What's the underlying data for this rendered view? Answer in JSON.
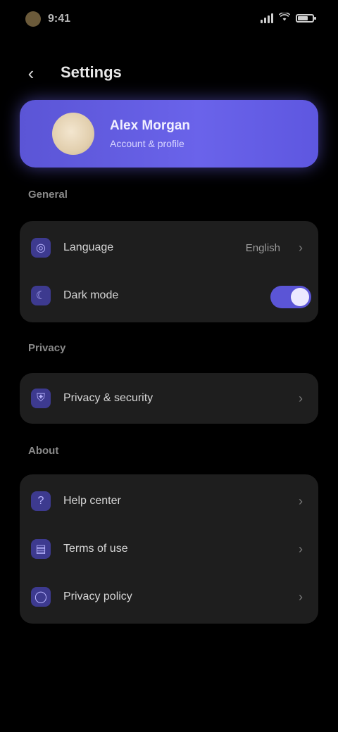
{
  "status_bar": {
    "time": "9:41",
    "battery_level": 0.8,
    "signal_level": 4
  },
  "header": {
    "title": "Settings",
    "back_icon": "chevron-left-icon"
  },
  "profile": {
    "name": "Alex Morgan",
    "subtitle": "Account & profile"
  },
  "sections": [
    {
      "label": "General",
      "rows": [
        {
          "label": "Language",
          "value": "English",
          "icon": "globe-icon",
          "control": "value"
        },
        {
          "label": "Dark mode",
          "icon": "moon-icon",
          "control": "toggle",
          "toggle_on": true
        }
      ]
    },
    {
      "label": "Privacy",
      "rows": [
        {
          "label": "Privacy & security",
          "icon": "shield-icon",
          "control": "chevron"
        }
      ]
    },
    {
      "label": "About",
      "rows": [
        {
          "label": "Help center",
          "icon": "help-icon",
          "control": "chevron"
        },
        {
          "label": "Terms of use",
          "icon": "document-icon",
          "control": "chevron"
        },
        {
          "label": "Privacy policy",
          "icon": "lock-icon",
          "control": "chevron"
        }
      ]
    }
  ],
  "colors": {
    "accent": "#5b55d6",
    "background": "#000000",
    "card": "#1e1e1e"
  }
}
